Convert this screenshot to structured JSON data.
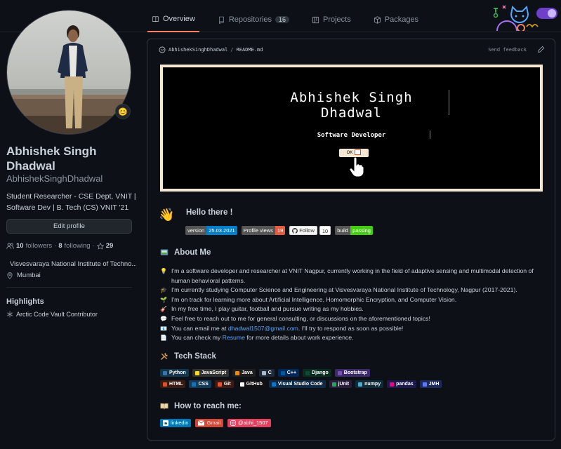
{
  "tabs": [
    {
      "label": "Overview",
      "icon": "book-icon"
    },
    {
      "label": "Repositories",
      "icon": "repo-icon",
      "count": "16"
    },
    {
      "label": "Projects",
      "icon": "project-icon"
    },
    {
      "label": "Packages",
      "icon": "package-icon"
    }
  ],
  "profile": {
    "name": "Abhishek Singh Dhadwal",
    "login": "AbhishekSinghDhadwal",
    "bio": "Student Researcher - CSE Dept, VNIT | Software Dev | B. Tech (CS) VNIT '21",
    "edit_label": "Edit profile",
    "followers_count": "10",
    "followers_label": "followers",
    "following_count": "8",
    "following_label": "following",
    "stars": "29",
    "organization": "Visvesvaraya National Institute of Techno...",
    "location": "Mumbai",
    "highlights_title": "Highlights",
    "highlight_item": "Arctic Code Vault Contributor",
    "status_emoji": "😊"
  },
  "readme": {
    "path_user": "AbhishekSinghDhadwal",
    "path_sep": "/",
    "path_file": "README.md",
    "feedback": "Send feedback",
    "banner_title": "Abhishek Singh Dhadwal",
    "banner_subtitle": "Software Developer",
    "banner_button": "OK",
    "hello_title": "Hello there !",
    "wave_emoji": "👋",
    "badges": [
      {
        "left": "version",
        "right": "25.03.2021",
        "color": "#007ec6"
      },
      {
        "left": "Profile views",
        "right": "19",
        "color": "#e05d44"
      },
      {
        "left": "build",
        "right": "passing",
        "color": "#4c1"
      }
    ],
    "follow_badge": {
      "left": "Follow",
      "right": "10"
    },
    "about_title": "About Me",
    "about_items": [
      {
        "emoji": "💡",
        "text": "I'm a software developer and researcher at VNIT Nagpur, currently working in the field of adaptive sensing and multimodal detection of human behavioral patterns."
      },
      {
        "emoji": "🎓",
        "text": "I'm currently studying Computer Science and Engineering at Visvesvaraya National Institute of Technology, Nagpur (2017-2021)."
      },
      {
        "emoji": "🌱",
        "text": "I'm on track for learning more about Artificial Intelligence, Homomorphic Encryption, and Computer Vision."
      },
      {
        "emoji": "🎸",
        "text": "In my free time, I play guitar, football and pursue writing as my hobbies."
      },
      {
        "emoji": "💬",
        "text": "Feel free to reach out to me for general consulting, or discussions on the aforementioned topics!"
      }
    ],
    "email_prefix": "You can email me at",
    "email": "dhadwal1507@gmail.com",
    "email_suffix": ". I'll try to respond as soon as possible!",
    "resume_prefix": "You can check my",
    "resume_link": "Resume",
    "resume_suffix": "for more details about work experience.",
    "email_emoji": "📧",
    "resume_emoji": "📄",
    "tech_title": "Tech Stack",
    "tech_row1": [
      {
        "label": "Python",
        "bg": "#14354c",
        "dot": "#3776ab"
      },
      {
        "label": "JavaScript",
        "bg": "#323330",
        "dot": "#f7df1e"
      },
      {
        "label": "Java",
        "bg": "#1e1e1e",
        "dot": "#ed8b00"
      },
      {
        "label": "C",
        "bg": "#1e2a3a",
        "dot": "#a8b9cc"
      },
      {
        "label": "C++",
        "bg": "#00295b",
        "dot": "#00599c"
      },
      {
        "label": "Django",
        "bg": "#092e20",
        "dot": "#0c4b33"
      },
      {
        "label": "Bootstrap",
        "bg": "#3d2a6b",
        "dot": "#7952b3"
      }
    ],
    "tech_row2": [
      {
        "label": "HTML",
        "bg": "#3b1a12",
        "dot": "#e34f26"
      },
      {
        "label": "CSS",
        "bg": "#123a5a",
        "dot": "#1572b6"
      },
      {
        "label": "Git",
        "bg": "#3a1a12",
        "dot": "#f05033"
      },
      {
        "label": "GitHub",
        "bg": "#121011",
        "dot": "#ffffff"
      },
      {
        "label": "Visual Studio Code",
        "bg": "#0e2a44",
        "dot": "#0078d7"
      },
      {
        "label": "jUnit",
        "bg": "#2a1c3a",
        "dot": "#25a162"
      },
      {
        "label": "numpy",
        "bg": "#0f2b3a",
        "dot": "#4dabcf"
      },
      {
        "label": "pandas",
        "bg": "#1b1a4b",
        "dot": "#e70488"
      },
      {
        "label": "JMH",
        "bg": "#1f2a5c",
        "dot": "#5a7bff"
      }
    ],
    "reach_title": "How to reach me:",
    "reach_links": [
      {
        "label": "linkedin",
        "bg": "#0077b5",
        "icon": "linkedin-icon"
      },
      {
        "label": "Gmail",
        "bg": "#d14836",
        "icon": "gmail-icon"
      },
      {
        "label": "@abhi_1507",
        "bg": "#e4405f",
        "icon": "instagram-icon"
      }
    ]
  },
  "colors": {
    "background": "#0d1117",
    "accent_tab": "#f78166",
    "link": "#58a6ff"
  }
}
